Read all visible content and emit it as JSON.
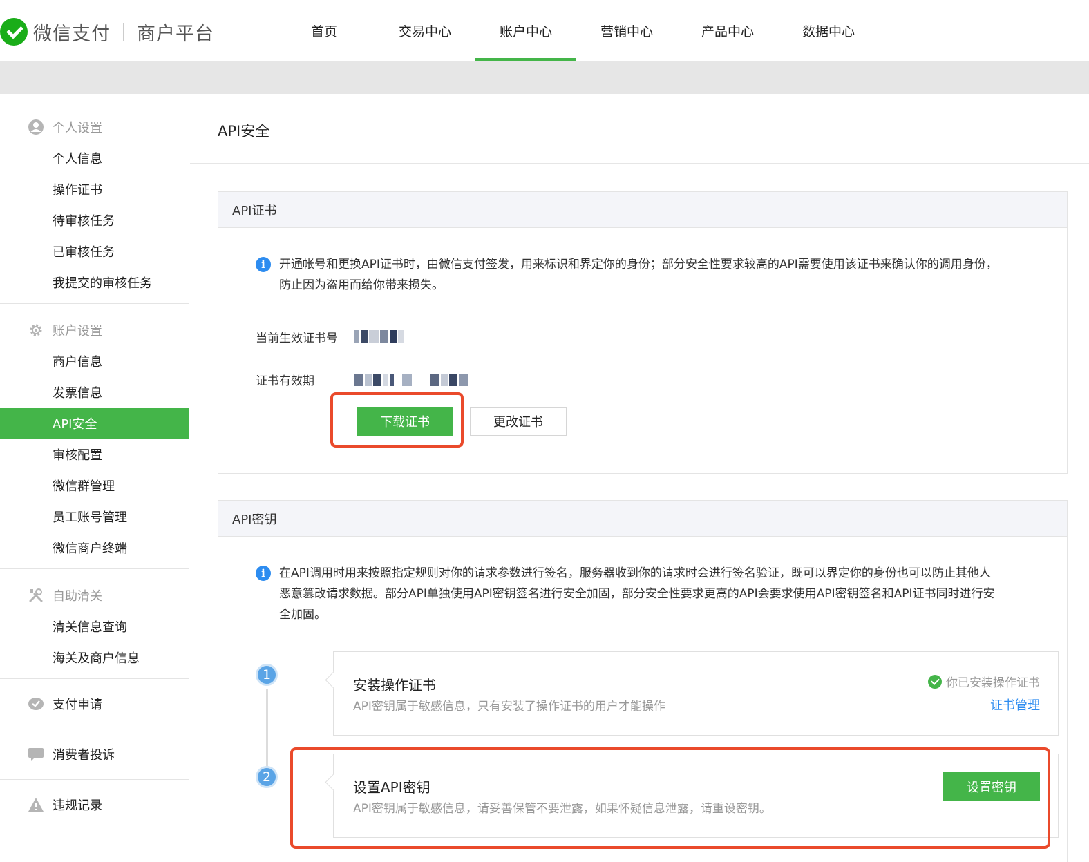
{
  "header": {
    "brand": "微信支付",
    "brand_sub": "商户平台",
    "nav": [
      {
        "label": "首页"
      },
      {
        "label": "交易中心"
      },
      {
        "label": "账户中心"
      },
      {
        "label": "营销中心"
      },
      {
        "label": "产品中心"
      },
      {
        "label": "数据中心"
      }
    ],
    "active_nav": "账户中心"
  },
  "sidebar": {
    "groups": [
      {
        "title": "个人设置",
        "icon": "user-icon",
        "items": [
          "个人信息",
          "操作证书",
          "待审核任务",
          "已审核任务",
          "我提交的审核任务"
        ]
      },
      {
        "title": "账户设置",
        "icon": "gear-icon",
        "items": [
          "商户信息",
          "发票信息",
          "API安全",
          "审核配置",
          "微信群管理",
          "员工账号管理",
          "微信商户终端"
        ]
      },
      {
        "title": "自助清关",
        "icon": "tools-icon",
        "items": [
          "清关信息查询",
          "海关及商户信息"
        ]
      }
    ],
    "singles": [
      {
        "title": "支付申请",
        "icon": "wechat-pay-icon"
      },
      {
        "title": "消费者投诉",
        "icon": "chat-icon"
      },
      {
        "title": "违规记录",
        "icon": "warning-icon"
      }
    ],
    "active_item": "API安全"
  },
  "main": {
    "page_title": "API安全",
    "cert_card": {
      "title": "API证书",
      "info_line1": "开通帐号和更换API证书时，由微信支付签发，用来标识和界定你的身份；部分安全性要求较高的API需要使用该证书来确认你的调用身份，",
      "info_line2": "防止因为盗用而给你带来损失。",
      "current_cert_label": "当前生效证书号",
      "validity_label": "证书有效期",
      "download_button": "下载证书",
      "change_button": "更改证书"
    },
    "key_card": {
      "title": "API密钥",
      "info_line1": "在API调用时用来按照指定规则对你的请求参数进行签名，服务器收到你的请求时会进行签名验证，既可以界定你的身份也可以防止其他人",
      "info_line2": "恶意篡改请求数据。部分API单独使用API密钥签名进行安全加固，部分安全性要求更高的API会要求使用API密钥签名和API证书同时进行安",
      "info_line3": "全加固。",
      "steps": [
        {
          "num": "1",
          "title": "安装操作证书",
          "desc": "API密钥属于敏感信息，只有安装了操作证书的用户才能操作",
          "status": "你已安装操作证书",
          "link": "证书管理"
        },
        {
          "num": "2",
          "title": "设置API密钥",
          "desc": "API密钥属于敏感信息，请妥善保管不要泄露，如果怀疑信息泄露，请重设密钥。",
          "button": "设置密钥"
        }
      ]
    }
  },
  "colors": {
    "brand_green": "#44b549",
    "highlight_red": "#ea4a2b",
    "info_blue": "#2d8cf0"
  }
}
